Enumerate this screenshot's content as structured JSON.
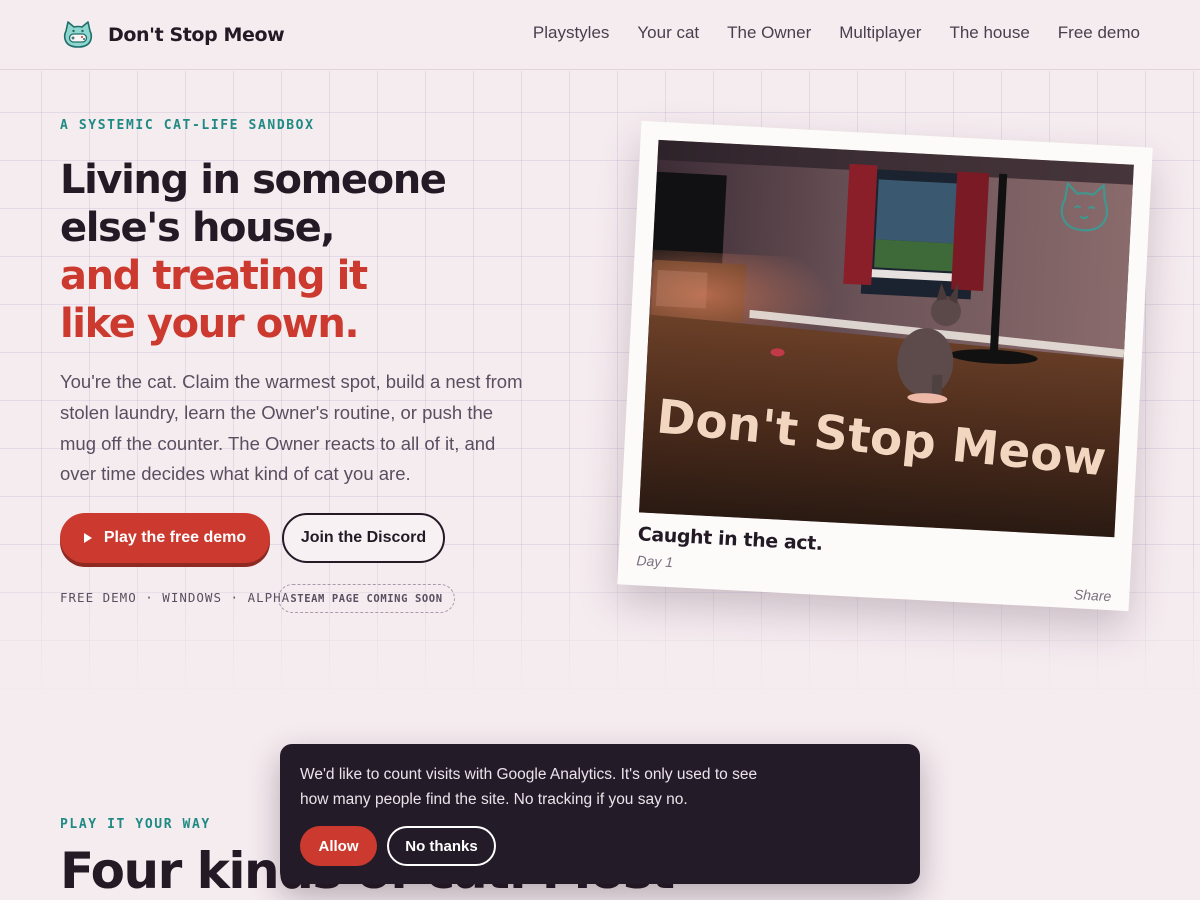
{
  "header": {
    "brand_name": "Don't Stop Meow",
    "logo_icon": "cat-face-gamepad-icon",
    "nav": [
      {
        "label": "Playstyles"
      },
      {
        "label": "Your cat"
      },
      {
        "label": "The Owner"
      },
      {
        "label": "Multiplayer"
      },
      {
        "label": "The house"
      },
      {
        "label": "Free demo"
      }
    ]
  },
  "hero": {
    "eyebrow": "A SYSTEMIC CAT-LIFE SANDBOX",
    "title_lines": [
      "Living in someone",
      "else's house,"
    ],
    "title_accent_lines": [
      "and treating it",
      "like your own."
    ],
    "body": "You're the cat. Claim the warmest spot, build a nest from stolen laundry, learn the Owner's routine, or push the mug off the counter. The Owner reacts to all of it, and over time decides what kind of cat you are.",
    "primary_cta": "Play the free demo",
    "secondary_cta": "Join the Discord",
    "platform_meta": "FREE DEMO · WINDOWS · ALPHA",
    "steam_badge": "STEAM PAGE COMING SOON"
  },
  "polaroid": {
    "photo_title": "Don't Stop Meow",
    "caption": "Caught in the act.",
    "day": "Day 1",
    "share_label": "Share"
  },
  "section_playstyles": {
    "eyebrow": "PLAY IT YOUR WAY",
    "title": "Four kinds of cat. Most"
  },
  "cookie_banner": {
    "text": "We'd like to count visits with Google Analytics. It's only used to see how many people find the site. No tracking if you say no.",
    "allow_label": "Allow",
    "decline_label": "No thanks"
  },
  "colors": {
    "background": "#f5ecf0",
    "ink": "#231a26",
    "accent_red": "#cc3a2f",
    "accent_teal": "#1f8a83",
    "banner_bg": "#241b29"
  }
}
